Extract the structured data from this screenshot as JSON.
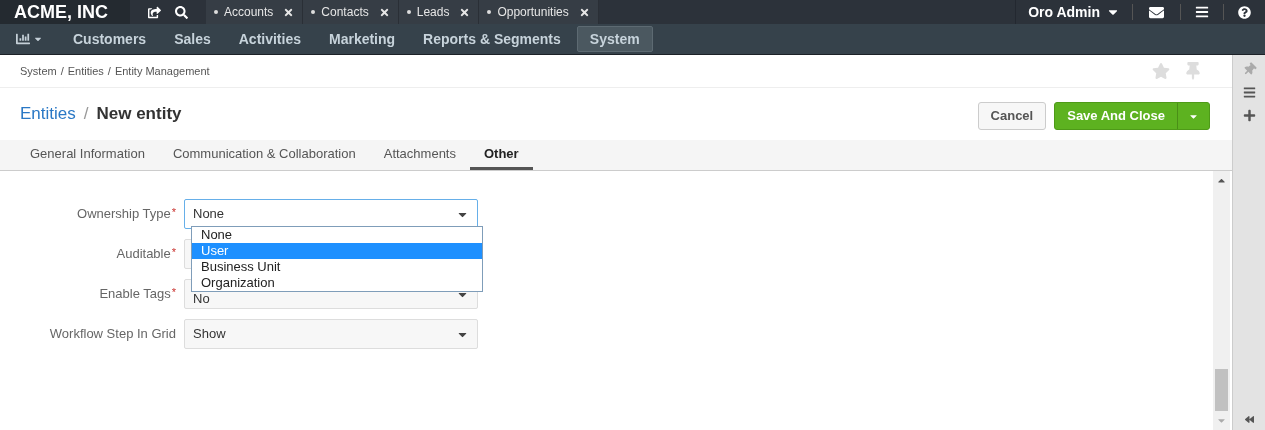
{
  "brand": "ACME, INC",
  "pinned_tabs": [
    {
      "label": "Accounts"
    },
    {
      "label": "Contacts"
    },
    {
      "label": "Leads"
    },
    {
      "label": "Opportunities"
    }
  ],
  "user_menu": {
    "label": "Oro Admin"
  },
  "main_menu": [
    {
      "label": "Customers",
      "selected": false
    },
    {
      "label": "Sales",
      "selected": false
    },
    {
      "label": "Activities",
      "selected": false
    },
    {
      "label": "Marketing",
      "selected": false
    },
    {
      "label": "Reports & Segments",
      "selected": false
    },
    {
      "label": "System",
      "selected": true
    }
  ],
  "breadcrumbs": [
    "System",
    "Entities",
    "Entity Management"
  ],
  "breadcrumb_separator": "/",
  "title": {
    "parent": "Entities",
    "separator": "/",
    "current": "New entity"
  },
  "required_mark": "*",
  "buttons": {
    "cancel": "Cancel",
    "save": "Save And Close"
  },
  "tabs": [
    {
      "label": "General Information",
      "selected": false
    },
    {
      "label": "Communication & Collaboration",
      "selected": false
    },
    {
      "label": "Attachments",
      "selected": false
    },
    {
      "label": "Other",
      "selected": true
    }
  ],
  "fields": [
    {
      "label": "Ownership Type",
      "required": true,
      "value": "None",
      "focused": true
    },
    {
      "label": "Auditable",
      "required": true
    },
    {
      "label": "Enable Tags",
      "required": true,
      "value": "No",
      "focused": false
    },
    {
      "label": "Workflow Step In Grid",
      "required": false,
      "value": "Show",
      "focused": false
    }
  ],
  "dropdown_options": [
    {
      "label": "None",
      "selected": false
    },
    {
      "label": "User",
      "selected": true
    },
    {
      "label": "Business Unit",
      "selected": false
    },
    {
      "label": "Organization",
      "selected": false
    }
  ]
}
